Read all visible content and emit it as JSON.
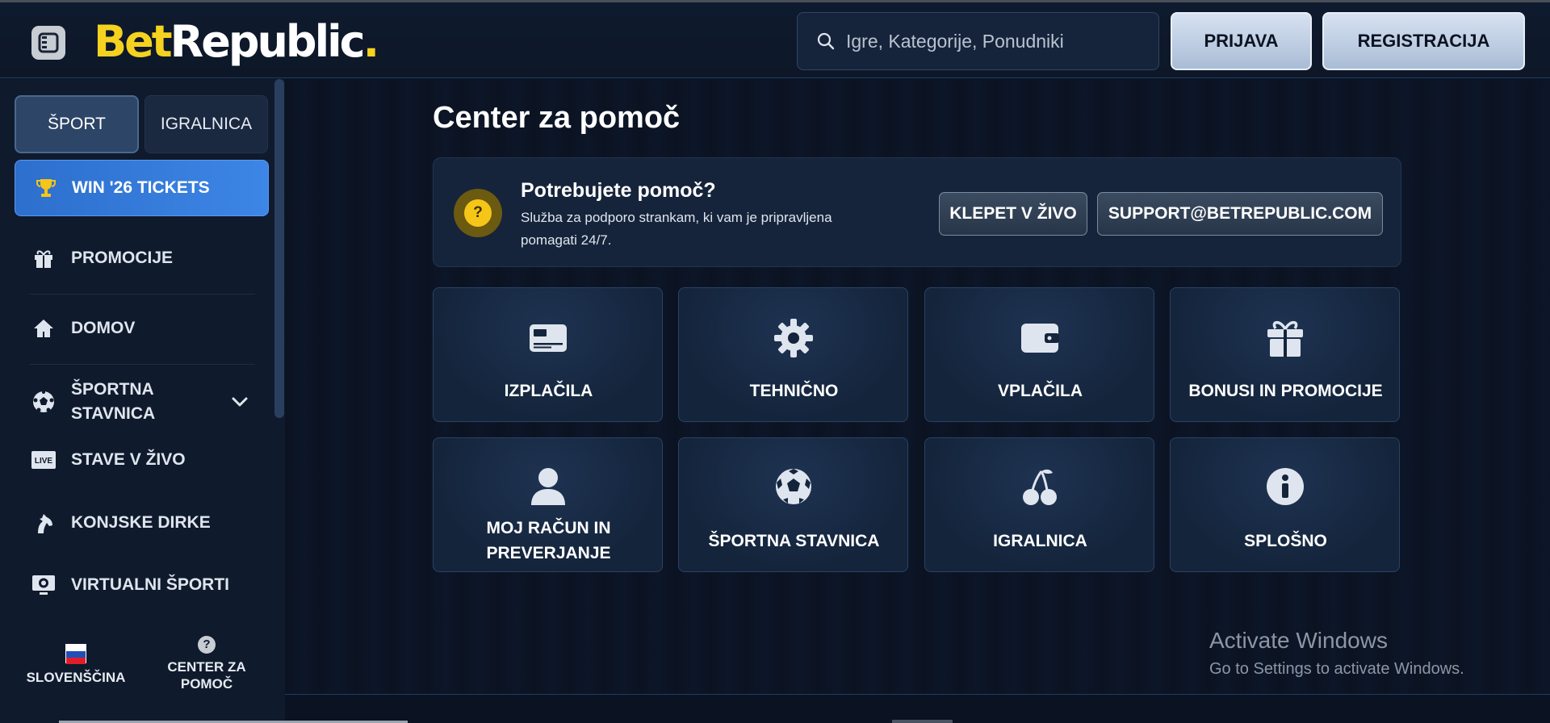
{
  "header": {
    "logo_bet": "Bet",
    "logo_republic": "Republic",
    "logo_dot": ".",
    "search_placeholder": "Igre, Kategorije, Ponudniki",
    "login_label": "PRIJAVA",
    "register_label": "REGISTRACIJA"
  },
  "sidebar": {
    "tabs": [
      {
        "label": "ŠPORT",
        "active": true
      },
      {
        "label": "IGRALNICA",
        "active": false
      }
    ],
    "highlight": {
      "label": "WIN '26 TICKETS",
      "icon": "trophy-icon"
    },
    "items": [
      {
        "label": "PROMOCIJE",
        "icon": "gift-icon"
      },
      {
        "label": "DOMOV",
        "icon": "home-icon"
      },
      {
        "label": "ŠPORTNA STAVNICA",
        "label_line1": "ŠPORTNA",
        "label_line2": "STAVNICA",
        "icon": "soccer-ball-icon"
      },
      {
        "label": "STAVE V ŽIVO",
        "icon": "live-icon"
      },
      {
        "label": "KONJSKE DIRKE",
        "icon": "horse-icon"
      },
      {
        "label": "VIRTUALNI ŠPORTI",
        "icon": "virtual-sports-icon"
      }
    ],
    "language": "SLOVENŠČINA",
    "help_line1": "CENTER ZA",
    "help_line2": "POMOČ"
  },
  "main": {
    "title": "Center za pomoč",
    "banner": {
      "title": "Potrebujete pomoč?",
      "description": "Služba za podporo strankam, ki vam je pripravljena pomagati 24/7.",
      "chat_label": "KLEPET V ŽIVO",
      "email_label": "SUPPORT@BETREPUBLIC.COM"
    },
    "categories": [
      {
        "label": "IZPLAČILA",
        "icon": "credit-card-icon"
      },
      {
        "label": "TEHNIČNO",
        "icon": "gear-icon"
      },
      {
        "label": "VPLAČILA",
        "icon": "wallet-icon"
      },
      {
        "label": "BONUSI IN PROMOCIJE",
        "icon": "gift-icon"
      },
      {
        "label": "MOJ RAČUN IN PREVERJANJE",
        "label_line1": "MOJ RAČUN IN",
        "label_line2": "PREVERJANJE",
        "icon": "user-icon"
      },
      {
        "label": "ŠPORTNA STAVNICA",
        "icon": "soccer-ball-icon"
      },
      {
        "label": "IGRALNICA",
        "icon": "cherries-icon"
      },
      {
        "label": "SPLOŠNO",
        "icon": "info-icon"
      }
    ]
  },
  "watermark": {
    "line1": "Activate Windows",
    "line2": "Go to Settings to activate Windows."
  },
  "colors": {
    "background": "#0b1322",
    "accent_blue": "#3d86e6",
    "logo_yellow": "#f5d21f",
    "help_yellow": "#f5c518"
  }
}
